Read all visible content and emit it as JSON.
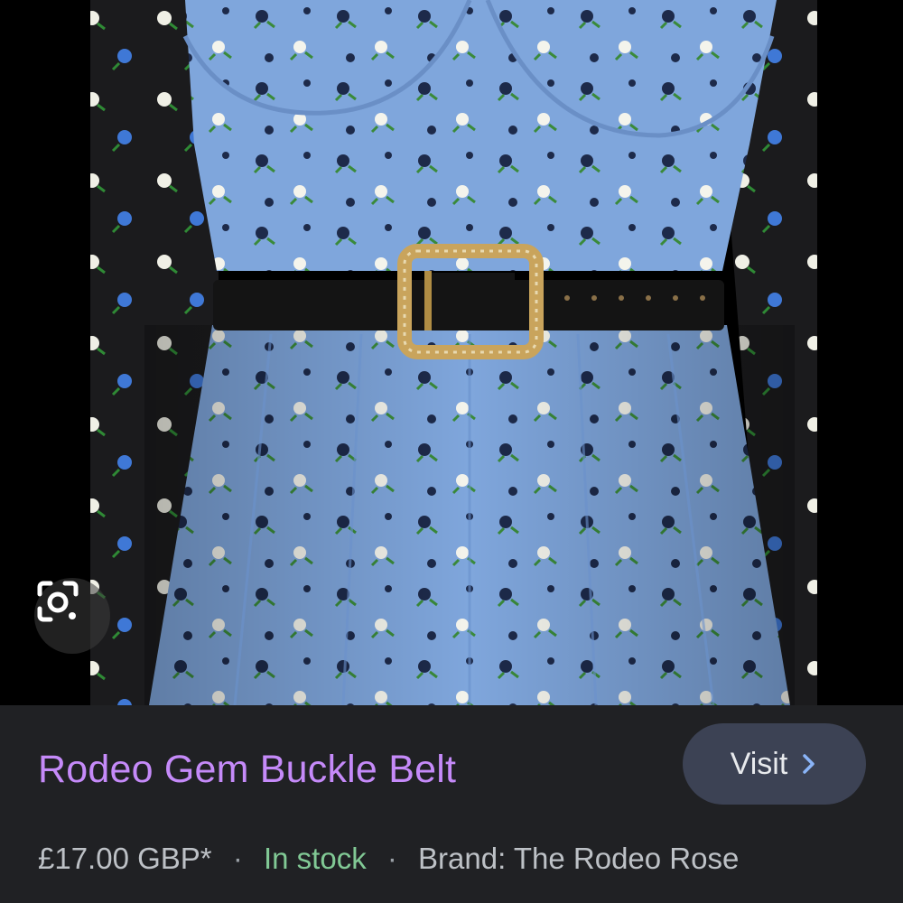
{
  "image": {
    "alt_subject": "blue-floral-dress-with-gem-buckle-belt",
    "colors": {
      "dress": "#7fa6dc",
      "jacket": "#1e1e1e",
      "belt": "#141414",
      "buckle": "#c9a45c"
    }
  },
  "lens": {
    "icon": "google-lens-icon"
  },
  "product": {
    "title": "Rodeo Gem Buckle Belt",
    "price": "£17.00 GBP*",
    "stock": "In stock",
    "brand": "Brand: The Rodeo Rose",
    "separator": "·"
  },
  "visit": {
    "label": "Visit",
    "icon": "chevron-right-icon"
  },
  "colors": {
    "panel": "#202124",
    "title": "#c58af9",
    "stock": "#81c995",
    "meta": "#bdc1c6",
    "button": "#3c4254"
  }
}
